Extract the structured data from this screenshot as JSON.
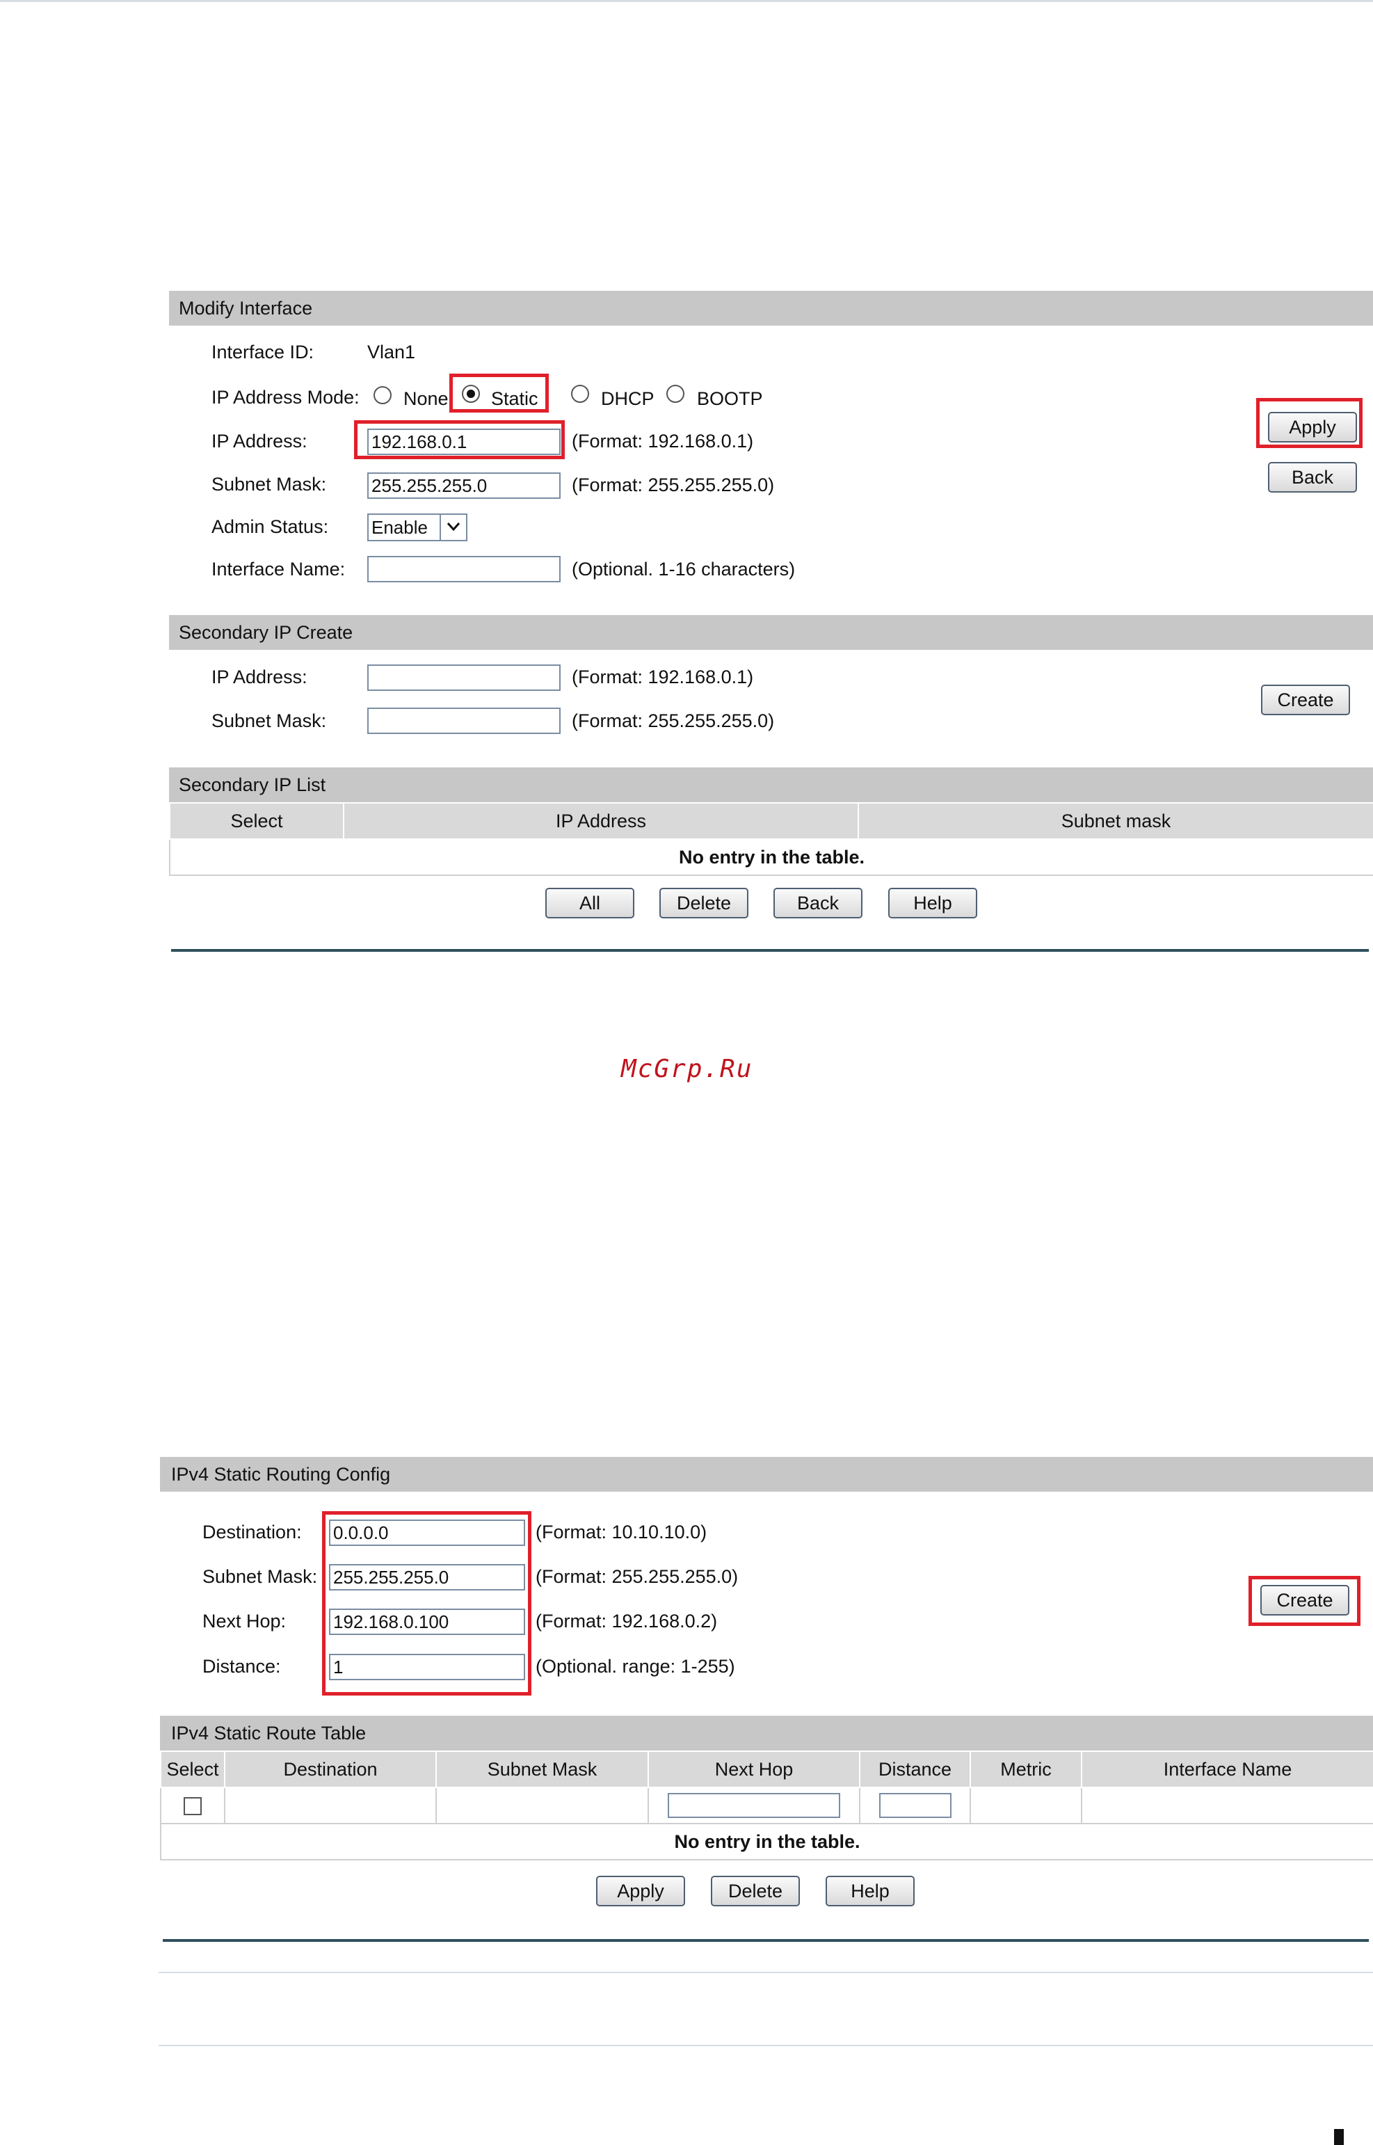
{
  "modify_interface": {
    "header": "Modify Interface",
    "interface_id_label": "Interface ID:",
    "interface_id_value": "Vlan1",
    "ip_mode_label": "IP Address Mode:",
    "modes": [
      "None",
      "Static",
      "DHCP",
      "BOOTP"
    ],
    "selected_mode": "Static",
    "ip_label": "IP Address:",
    "ip_value": "192.168.0.1",
    "ip_hint": "(Format: 192.168.0.1)",
    "mask_label": "Subnet Mask:",
    "mask_value": "255.255.255.0",
    "mask_hint": "(Format: 255.255.255.0)",
    "admin_label": "Admin Status:",
    "admin_value": "Enable",
    "name_label": "Interface Name:",
    "name_value": "",
    "name_hint": "(Optional. 1-16 characters)",
    "apply_button": "Apply",
    "back_button": "Back"
  },
  "secondary_ip_create": {
    "header": "Secondary IP Create",
    "ip_label": "IP Address:",
    "ip_value": "",
    "ip_hint": "(Format: 192.168.0.1)",
    "mask_label": "Subnet Mask:",
    "mask_value": "",
    "mask_hint": "(Format: 255.255.255.0)",
    "create_button": "Create"
  },
  "secondary_ip_list": {
    "header": "Secondary IP List",
    "columns": [
      "Select",
      "IP Address",
      "Subnet mask"
    ],
    "empty_text": "No entry in the table.",
    "buttons": [
      "All",
      "Delete",
      "Back",
      "Help"
    ]
  },
  "watermark": "McGrp.Ru",
  "ipv4_static_routing": {
    "header": "IPv4 Static Routing Config",
    "dest_label": "Destination:",
    "dest_value": "0.0.0.0",
    "dest_hint": "(Format: 10.10.10.0)",
    "mask_label": "Subnet Mask:",
    "mask_value": "255.255.255.0",
    "mask_hint": "(Format: 255.255.255.0)",
    "nexthop_label": "Next Hop:",
    "nexthop_value": "192.168.0.100",
    "nexthop_hint": "(Format: 192.168.0.2)",
    "distance_label": "Distance:",
    "distance_value": "1",
    "distance_hint": "(Optional. range: 1-255)",
    "create_button": "Create"
  },
  "ipv4_route_table": {
    "header": "IPv4 Static Route Table",
    "columns": [
      "Select",
      "Destination",
      "Subnet Mask",
      "Next Hop",
      "Distance",
      "Metric",
      "Interface Name"
    ],
    "empty_text": "No entry in the table.",
    "buttons": [
      "Apply",
      "Delete",
      "Help"
    ]
  },
  "colors": {
    "highlight": "#e0202a",
    "section_header": "#c7c7c7",
    "divider": "#2f4f5c"
  }
}
